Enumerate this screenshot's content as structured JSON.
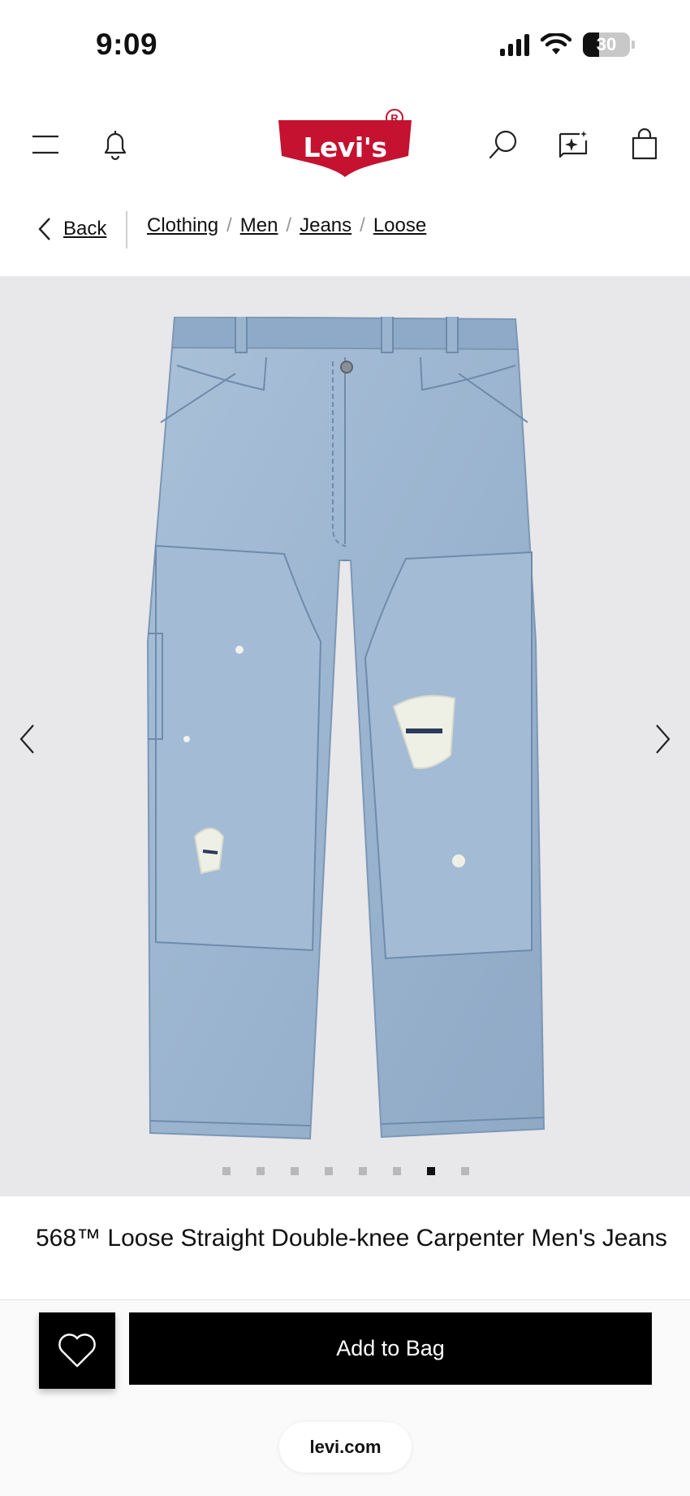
{
  "status_bar": {
    "time": "9:09",
    "battery_level": "30",
    "icons": [
      "signal-icon",
      "wifi-icon",
      "battery-icon"
    ]
  },
  "header": {
    "logo_text": "Levi's",
    "logo_registered_mark": "R",
    "brand_color": "#c41230",
    "icons": [
      "menu-icon",
      "bell-icon",
      "search-icon",
      "ai-sparkle-icon",
      "bag-icon"
    ]
  },
  "breadcrumb": {
    "back_label": "Back",
    "items": [
      {
        "label": "Clothing"
      },
      {
        "label": "Men"
      },
      {
        "label": "Jeans"
      },
      {
        "label": "Loose"
      }
    ],
    "separator": "/"
  },
  "gallery": {
    "background": "#e8e7ea",
    "image_subject": "light-wash distressed carpenter jeans",
    "dot_count": 8,
    "active_index": 6
  },
  "product": {
    "title": "568™ Loose Straight Double-knee Carpenter Men's Jeans"
  },
  "actions": {
    "add_to_bag_label": "Add to Bag",
    "wishlist_icon": "heart-icon"
  },
  "browser": {
    "url": "levi.com"
  }
}
